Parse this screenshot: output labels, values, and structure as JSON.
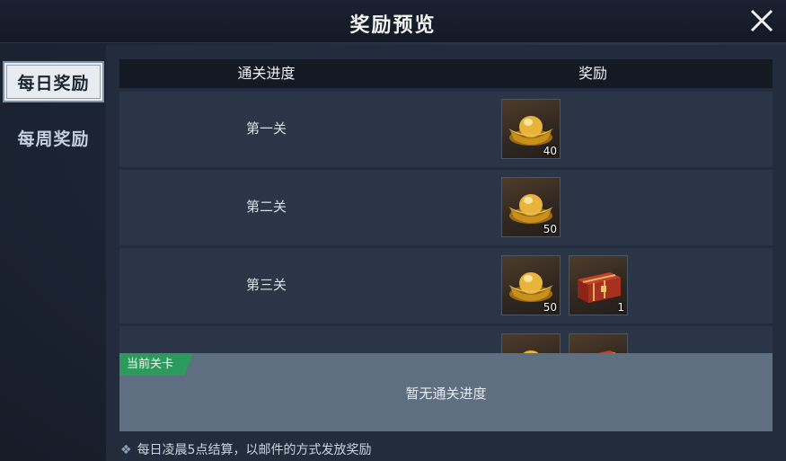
{
  "header": {
    "title": "奖励预览"
  },
  "sidebar": {
    "tabs": [
      {
        "label": "每日奖励",
        "active": true
      },
      {
        "label": "每周奖励",
        "active": false
      }
    ]
  },
  "table": {
    "headers": {
      "progress": "通关进度",
      "reward": "奖励"
    },
    "rows": [
      {
        "stage": "第一关",
        "rewards": [
          {
            "icon": "gold-ingot-icon",
            "qty": "40"
          }
        ]
      },
      {
        "stage": "第二关",
        "rewards": [
          {
            "icon": "gold-ingot-icon",
            "qty": "50"
          }
        ]
      },
      {
        "stage": "第三关",
        "rewards": [
          {
            "icon": "gold-ingot-icon",
            "qty": "50"
          },
          {
            "icon": "treasure-chest-icon",
            "qty": "1"
          }
        ]
      },
      {
        "stage": "",
        "rewards": [
          {
            "icon": "gold-ingot-icon",
            "qty": ""
          },
          {
            "icon": "treasure-chest-icon",
            "qty": ""
          }
        ]
      }
    ]
  },
  "current": {
    "tag": "当前关卡",
    "text": "暂无通关进度"
  },
  "footer": {
    "note": "每日凌晨5点结算，以邮件的方式发放奖励"
  },
  "colors": {
    "accent_green": "#2c9a5c",
    "tab_active_bg": "#e8ecf1"
  }
}
